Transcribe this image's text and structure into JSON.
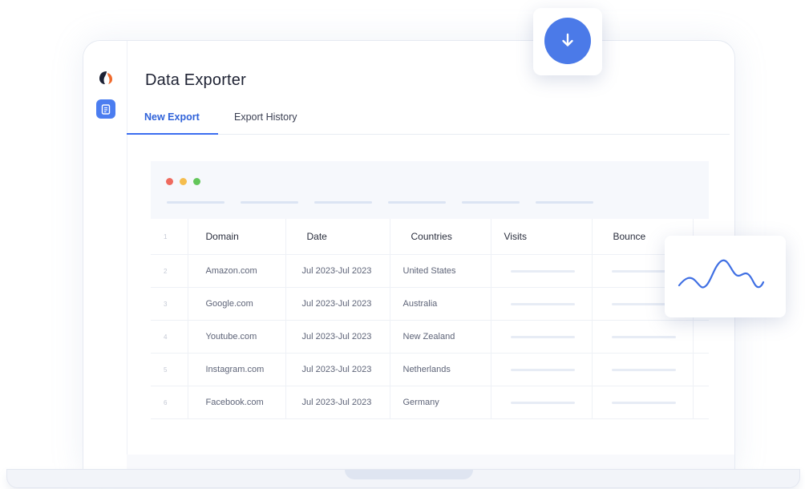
{
  "app": {
    "title": "Data Exporter"
  },
  "tabs": [
    {
      "label": "New Export",
      "active": true
    },
    {
      "label": "Export History",
      "active": false
    }
  ],
  "table": {
    "header": {
      "num": "1",
      "columns": [
        "Domain",
        "Date",
        "Countries",
        "Visits",
        "Bounce"
      ]
    },
    "rows": [
      {
        "num": "2",
        "domain": "Amazon.com",
        "date": "Jul 2023-Jul 2023",
        "country": "United States"
      },
      {
        "num": "3",
        "domain": "Google.com",
        "date": "Jul 2023-Jul 2023",
        "country": "Australia"
      },
      {
        "num": "4",
        "domain": "Youtube.com",
        "date": "Jul 2023-Jul 2023",
        "country": "New Zealand"
      },
      {
        "num": "5",
        "domain": "Instagram.com",
        "date": "Jul 2023-Jul 2023",
        "country": "Netherlands"
      },
      {
        "num": "6",
        "domain": "Facebook.com",
        "date": "Jul 2023-Jul 2023",
        "country": "Germany"
      }
    ]
  },
  "colors": {
    "accent": "#4b7ae8",
    "active_tab": "#2f62d9",
    "window_dots": [
      "#ef6a5e",
      "#f5bd4e",
      "#63c65a"
    ]
  },
  "icons": {
    "logo": "logo-icon",
    "sidebar": "document-icon",
    "download": "download-arrow-icon",
    "wave": "wave-chart-icon"
  }
}
